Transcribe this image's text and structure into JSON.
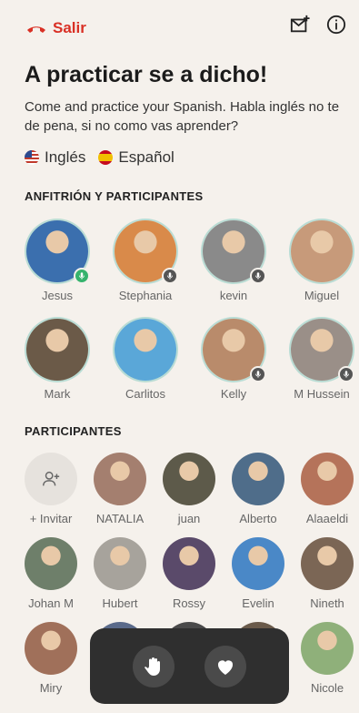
{
  "header": {
    "exit_label": "Salir"
  },
  "room": {
    "title": "A practicar se a dicho!",
    "description": "Come and practice your Spanish. Habla inglés no te de pena, si no como vas aprender?",
    "languages": [
      "Inglés",
      "Español"
    ]
  },
  "sections": {
    "hosts": "ANFITRIÓN Y PARTICIPANTES",
    "participants": "PARTICIPANTES"
  },
  "hosts": [
    {
      "name": "Jesus",
      "color": "#3b6fae",
      "mic": "on"
    },
    {
      "name": "Stephania",
      "color": "#d98a4a",
      "mic": "muted"
    },
    {
      "name": "kevin",
      "color": "#8a8a8a",
      "mic": "muted"
    },
    {
      "name": "Miguel",
      "color": "#c79a7a",
      "mic": "none"
    },
    {
      "name": "Mark",
      "color": "#6b5a48",
      "mic": "none"
    },
    {
      "name": "Carlitos",
      "color": "#5aa7d8",
      "mic": "none"
    },
    {
      "name": "Kelly",
      "color": "#b98b6b",
      "mic": "muted"
    },
    {
      "name": "M Hussein",
      "color": "#9a8f88",
      "mic": "muted"
    }
  ],
  "participants": [
    {
      "name": "+ Invitar",
      "invite": true
    },
    {
      "name": "NATALIA",
      "color": "#a47f6f"
    },
    {
      "name": "juan",
      "color": "#5d5a4a"
    },
    {
      "name": "Alberto",
      "color": "#4f6d8a"
    },
    {
      "name": "Alaaeldi",
      "color": "#b5735a"
    },
    {
      "name": "Johan M",
      "color": "#6e7f6a"
    },
    {
      "name": "Hubert",
      "color": "#a7a39c"
    },
    {
      "name": "Rossy",
      "color": "#5a4a6a"
    },
    {
      "name": "Evelin",
      "color": "#4a88c7"
    },
    {
      "name": "Nineth",
      "color": "#7b6655"
    },
    {
      "name": "Miry",
      "color": "#a0705a"
    },
    {
      "name": "",
      "color": "#5a6a8a"
    },
    {
      "name": "",
      "color": "#4a4a4a"
    },
    {
      "name": "",
      "color": "#6a5a4a"
    },
    {
      "name": "Nicole",
      "color": "#8fb07a"
    }
  ],
  "colors": {
    "accent": "#d93025",
    "bottom_bar": "#2f2f2f"
  },
  "icons": {
    "raise_hand": "hand-icon",
    "react": "heart-icon"
  }
}
